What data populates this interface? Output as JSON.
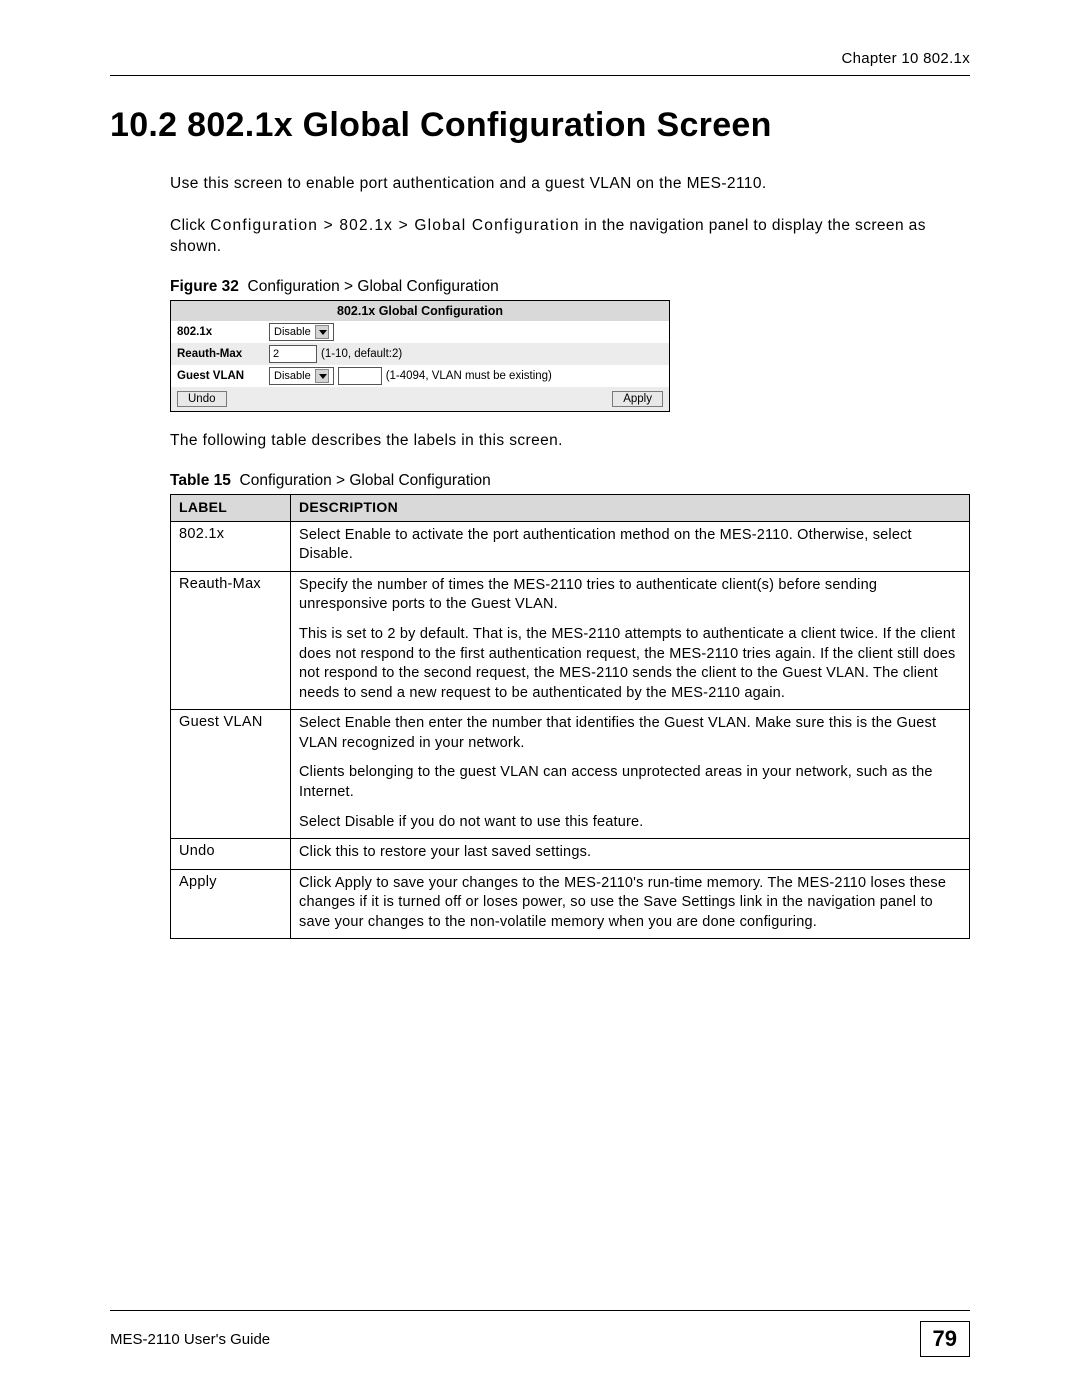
{
  "header": {
    "chapter": "Chapter 10 802.1x"
  },
  "section": {
    "heading": "10.2  802.1x Global Configuration Screen",
    "intro": "Use this screen to enable port authentication and a guest VLAN on the MES-2110.",
    "nav_prefix": "Click ",
    "nav_path": "Configuration > 802.1x > Global Configuration",
    "nav_suffix": " in the navigation panel to display the screen as shown."
  },
  "figure": {
    "label": "Figure 32",
    "title": "Configuration > Global Configuration"
  },
  "ui": {
    "title": "802.1x Global Configuration",
    "rows": {
      "r1_label": "802.1x",
      "r1_select": "Disable",
      "r2_label": "Reauth-Max",
      "r2_value": "2",
      "r2_note": "(1-10, default:2)",
      "r3_label": "Guest VLAN",
      "r3_select": "Disable",
      "r3_note": "(1-4094, VLAN must be existing)"
    },
    "buttons": {
      "undo": "Undo",
      "apply": "Apply"
    }
  },
  "post_figure_text": "The following table describes the labels in this screen.",
  "table_caption": {
    "label": "Table 15",
    "title": "Configuration > Global Configuration"
  },
  "table": {
    "col1": "LABEL",
    "col2": "DESCRIPTION",
    "rows": [
      {
        "label": "802.1x",
        "desc1": "Select Enable to activate the port authentication method on the MES-2110. Otherwise, select Disable."
      },
      {
        "label": "Reauth-Max",
        "desc1": "Specify the number of times the MES-2110 tries to authenticate client(s) before sending unresponsive ports to the Guest VLAN.",
        "desc2": "This is set to 2 by default. That is, the MES-2110 attempts to authenticate a client twice. If the client does not respond to the first authentication request, the MES-2110 tries again. If the client still does not respond to the second request, the MES-2110 sends the client to the Guest VLAN. The client needs to send a new request to be authenticated by the MES-2110 again."
      },
      {
        "label": "Guest VLAN",
        "desc1": "Select Enable then enter the number that identifies the Guest VLAN. Make sure this is the Guest VLAN recognized in your network.",
        "desc2": "Clients belonging to the guest VLAN can access unprotected areas in your network, such as the Internet.",
        "desc3": "Select Disable if you do not want to use this feature."
      },
      {
        "label": "Undo",
        "desc1": "Click this to restore your last saved settings."
      },
      {
        "label": "Apply",
        "desc1": "Click Apply to save your changes to the MES-2110's run-time memory. The MES-2110 loses these changes if it is turned off or loses power, so use the Save Settings link in the navigation panel to save your changes to the non-volatile memory when you are done configuring."
      }
    ]
  },
  "footer": {
    "guide": "MES-2110 User's Guide",
    "page": "79"
  }
}
